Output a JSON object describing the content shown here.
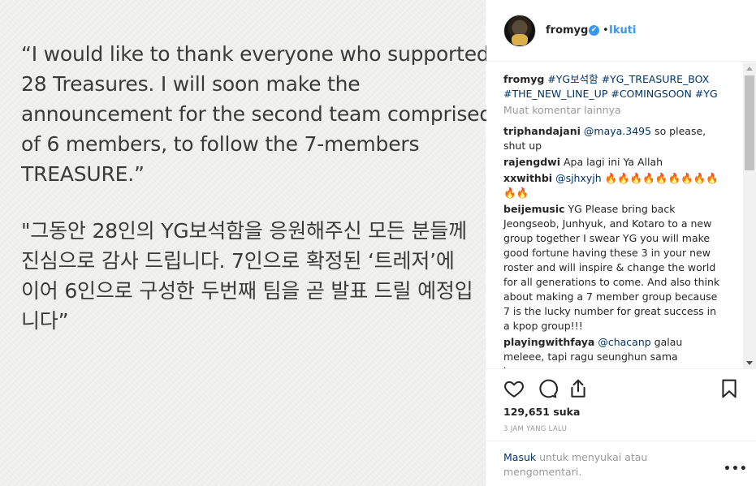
{
  "photo": {
    "english_lines": [
      "“I would like to thank everyone who supported",
      "28 Treasures. I will soon make the",
      "announcement for the second team comprised",
      "of 6 members, to follow the 7-members",
      "TREASURE.”"
    ],
    "korean_lines": [
      "\"그동안 28인의 YG보석함을 응원해주신 모든 분들께",
      "진심으로 감사 드립니다. 7인으로 확정된 ‘트레저’에",
      "이어 6인으로 구성한 두번째 팀을 곧 발표 드릴 예정입",
      "니다”"
    ]
  },
  "header": {
    "username": "fromyg",
    "verified_mark": "✔",
    "dot": "•",
    "follow_label": "Ikuti"
  },
  "caption": {
    "username": "fromyg",
    "tags": [
      "#YG보석함",
      "#YG_TREASURE_BOX",
      "#THE_NEW_LINE_UP",
      "#COMINGSOON",
      "#YG"
    ]
  },
  "load_more_label": "Muat komentar lainnya",
  "comments": [
    {
      "user": "triphandajani",
      "mention": "@maya.3495",
      "text": " so please, shut up"
    },
    {
      "user": "rajengdwi",
      "mention": "",
      "text": "Apa lagi ini Ya Allah"
    },
    {
      "user": "xxwithbi",
      "mention": "@sjhxyjh",
      "text": " 🔥🔥🔥🔥🔥🔥🔥🔥🔥🔥🔥"
    },
    {
      "user": "beijemusic",
      "mention": "",
      "text": "YG Please bring back Jeongseob, Junhyuk, and Kotaro to a new group together I swear YG you will make good fortune having these 3 in your new roster and will inspire & change the world for all generations to come. And also think about making a 7 member group because 7 is the lucky number for great success in a kpop group!!!"
    },
    {
      "user": "playingwithfaya",
      "mention": "@chacanp",
      "text": " galau meleee, tapi ragu seunghun sama byounggon"
    }
  ],
  "likes_text": "129,651 suka",
  "time_text": "3 JAM YANG LALU",
  "footer": {
    "login_label": "Masuk",
    "rest_text": " untuk menyukai atau mengomentari."
  },
  "more_label": "•••"
}
